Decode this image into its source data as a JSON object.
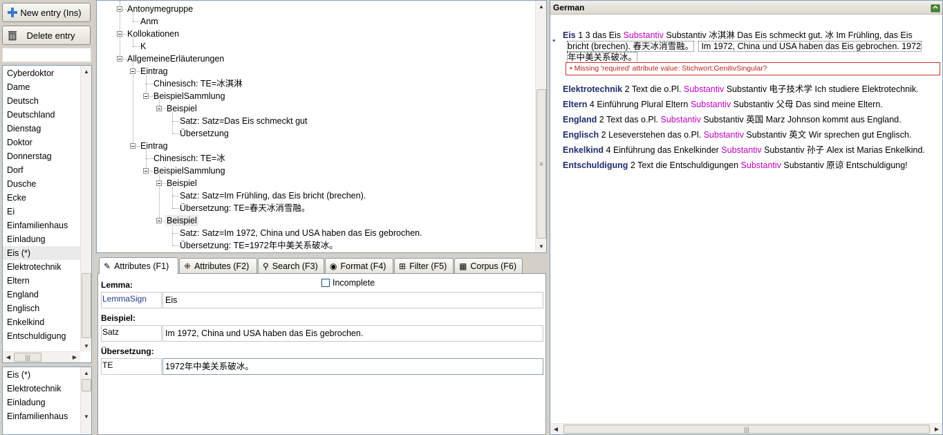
{
  "toolbar": {
    "new_entry": "New entry (Ins)",
    "delete_entry": "Delete entry"
  },
  "lemma_list": {
    "items": [
      "Cyberdoktor",
      "Dame",
      "Deutsch",
      "Deutschland",
      "Dienstag",
      "Doktor",
      "Donnerstag",
      "Dorf",
      "Dusche",
      "Ecke",
      "Ei",
      "Einfamilienhaus",
      "Einladung",
      "Eis (*)",
      "Elektrotechnik",
      "Eltern",
      "England",
      "Englisch",
      "Enkelkind",
      "Entschuldigung"
    ],
    "selected": "Eis (*)"
  },
  "history_list": {
    "items": [
      "Eis (*)",
      "Elektrotechnik",
      "Einladung",
      "Einfamilienhaus"
    ]
  },
  "tree": {
    "n0": "Antonymegruppe",
    "n1": "Anm",
    "n2": "Kollokationen",
    "n3": "K",
    "n4": "AllgemeineErläuterungen",
    "n5": "Eintrag",
    "n6": "Chinesisch:  TE=冰淇淋",
    "n7": "BeispielSammlung",
    "n8": "Beispiel",
    "n9": "Satz:  Satz=Das Eis schmeckt gut",
    "n10": "Übersetzung",
    "n11": "Eintrag",
    "n12": "Chinesisch:  TE=冰",
    "n13": "BeispielSammlung",
    "n14": "Beispiel",
    "n15": "Satz:  Satz=Im Frühling, das Eis bricht (brechen).",
    "n16": "Übersetzung:  TE=春天冰消雪融。",
    "n17": "Beispiel",
    "n18": "Satz:  Satz=Im 1972, China und USA haben das Eis gebrochen.",
    "n19": "Übersetzung:  TE=1972年中美关系破冰。"
  },
  "tabs": [
    "Attributes (F1)",
    "Attributes (F2)",
    "Search (F3)",
    "Format (F4)",
    "Filter (F5)",
    "Corpus (F6)"
  ],
  "attributes": {
    "incomplete_label": "Incomplete",
    "lemma_section": "Lemma:",
    "lemma_field": "LemmaSign",
    "lemma_value": "Eis",
    "beispiel_section": "Beispiel:",
    "satz_field": "Satz",
    "satz_value": "Im 1972, China und USA haben das Eis gebrochen.",
    "ubersetzung_section": "Übersetzung:",
    "te_field": "TE",
    "te_value": "1972年中美关系破冰。"
  },
  "preview": {
    "title": "German",
    "asterisk": "*",
    "eis_hw": "Eis",
    "eis_a": " 1 3 das Eis ",
    "eis_pos": "Substantiv",
    "eis_b": " Substantiv 冰淇淋 Das Eis schmeckt gut. 冰 Im Frühling, das Eis",
    "eis_c": "bricht (brechen). 春天冰消雪融。",
    "eis_d": " Im 1972, China und USA haben das Eis gebrochen. 1972",
    "eis_e": "年中美关系破冰。",
    "error": "• Missing 'required' attribute value: Stichwort:GenitivSingular?",
    "entries": [
      {
        "hw": "Elektrotechnik",
        "a": " 2 Text die o.Pl. ",
        "pos": "Substantiv",
        "b": " Substantiv 电子技术学 Ich studiere Elektrotechnik."
      },
      {
        "hw": "Eltern",
        "a": " 4 Einführung Plural Eltern ",
        "pos": "Substantiv",
        "b": " Substantiv 父母 Das sind meine Eltern."
      },
      {
        "hw": "England",
        "a": " 2 Text das o.Pl. ",
        "pos": "Substantiv",
        "b": " Substantiv 英国 Marz Johnson kommt aus England."
      },
      {
        "hw": "Englisch",
        "a": " 2 Leseverstehen das o.Pl. ",
        "pos": "Substantiv",
        "b": " Substantiv 英文 Wir sprechen gut Englisch."
      },
      {
        "hw": "Enkelkind",
        "a": " 4 Einführung das Enkelkinder ",
        "pos": "Substantiv",
        "b": " Substantiv 孙子 Alex ist Marias Enkelkind."
      },
      {
        "hw": "Entschuldigung",
        "a": " 2 Text die Entschuldigungen ",
        "pos": "Substantiv",
        "b": " Substantiv 原谅 Entschuldigung!"
      }
    ]
  }
}
